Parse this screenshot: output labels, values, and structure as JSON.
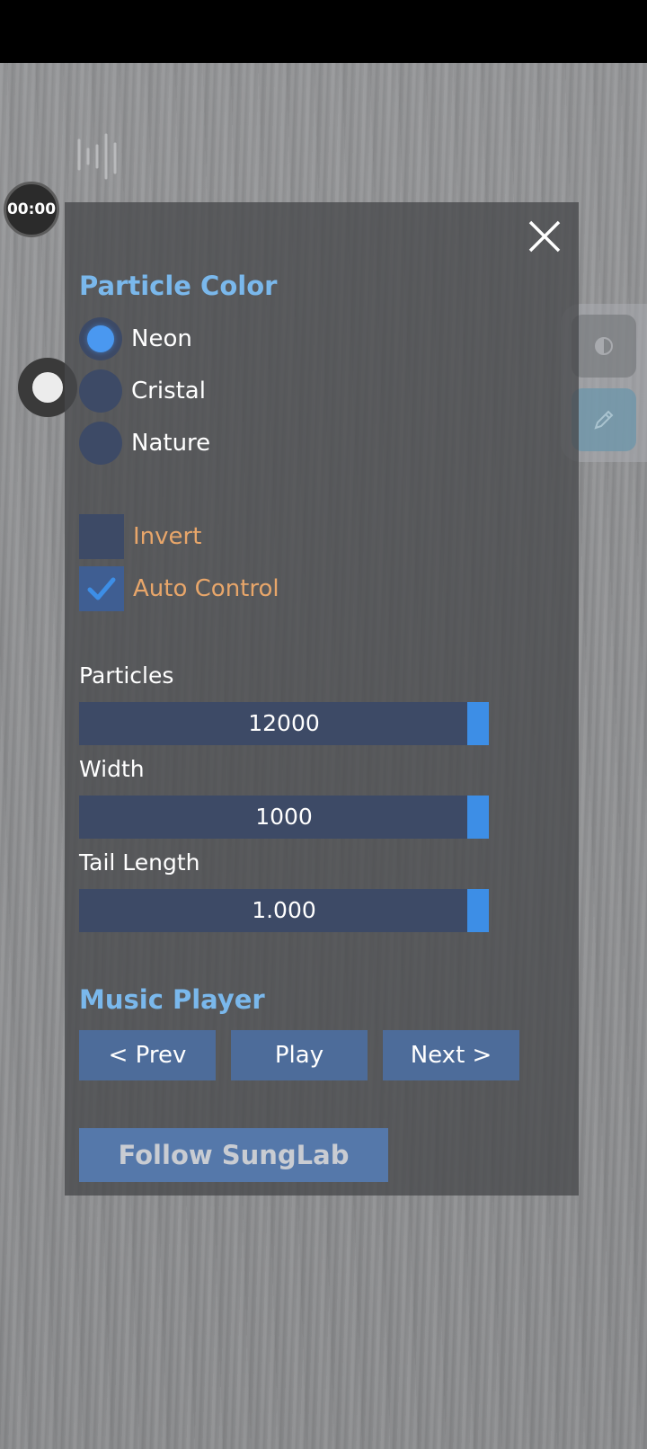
{
  "timer": {
    "text": "00:00"
  },
  "panel": {
    "particle_color": {
      "title": "Particle Color",
      "options": [
        {
          "label": "Neon",
          "selected": true
        },
        {
          "label": "Cristal",
          "selected": false
        },
        {
          "label": "Nature",
          "selected": false
        }
      ]
    },
    "toggles": [
      {
        "label": "Invert",
        "checked": false
      },
      {
        "label": "Auto Control",
        "checked": true
      }
    ],
    "sliders": [
      {
        "label": "Particles",
        "value": "12000",
        "fraction": 1.0
      },
      {
        "label": "Width",
        "value": "1000",
        "fraction": 1.0
      },
      {
        "label": "Tail Length",
        "value": "1.000",
        "fraction": 1.0
      }
    ],
    "music_player": {
      "title": "Music Player",
      "prev_label": "< Prev",
      "play_label": "Play",
      "next_label": "Next >"
    },
    "follow_label": "Follow SungLab"
  },
  "icons": {
    "close": "close-icon",
    "audio": "audio-wave-icon",
    "contrast": "contrast-icon",
    "pen": "pen-icon",
    "check": "checkmark-icon"
  },
  "colors": {
    "accent": "#4a98f0",
    "title": "#7ab8ec",
    "toggle_label": "#e8a66a",
    "control_bg": "#3d4a66"
  }
}
